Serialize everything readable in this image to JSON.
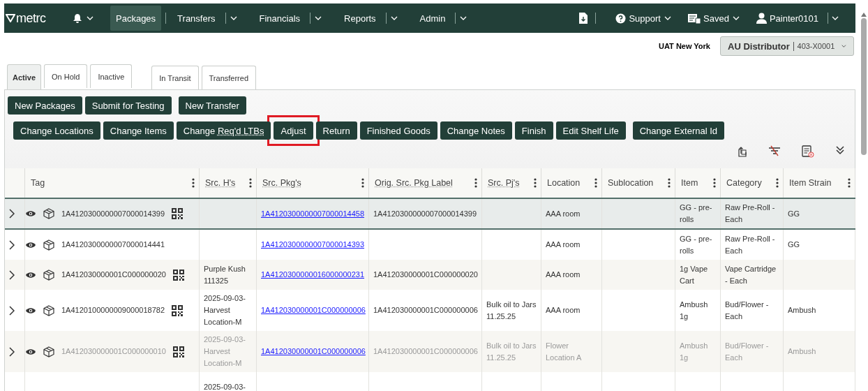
{
  "nav": {
    "logo": "metrc",
    "items": [
      {
        "label": "Packages",
        "selected": true,
        "dropdown": false
      },
      {
        "label": "Transfers",
        "selected": false,
        "dropdown": true
      },
      {
        "label": "Financials",
        "selected": false,
        "dropdown": true
      },
      {
        "label": "Reports",
        "selected": false,
        "dropdown": true
      },
      {
        "label": "Admin",
        "selected": false,
        "dropdown": true
      }
    ],
    "right_items": [
      {
        "kind": "download"
      },
      {
        "kind": "support",
        "label": "Support"
      },
      {
        "kind": "saved",
        "label": "Saved"
      },
      {
        "kind": "user",
        "label": "Painter0101"
      }
    ]
  },
  "facility": {
    "state": "UAT New York",
    "name": "AU Distributor",
    "license": "403-X0001"
  },
  "tab_groups": [
    [
      {
        "label": "Active",
        "selected": true
      },
      {
        "label": "On Hold",
        "selected": false
      },
      {
        "label": "Inactive",
        "selected": false
      }
    ],
    [
      {
        "label": "In Transit",
        "selected": false
      },
      {
        "label": "Transferred",
        "selected": false
      }
    ]
  ],
  "button_rows": [
    [
      [
        {
          "label": "New Packages",
          "highlighted": false
        },
        {
          "label": "Submit for Testing",
          "highlighted": false
        }
      ],
      [
        {
          "label": "New Transfer",
          "highlighted": false
        }
      ]
    ],
    [
      [
        {
          "label": "Change Locations",
          "highlighted": false
        },
        {
          "label": "Change Items",
          "highlighted": false
        },
        {
          "label": "Change **Req'd LTBs**",
          "highlighted": false
        },
        {
          "label": "Adjust",
          "highlighted": true
        },
        {
          "label": "Return",
          "highlighted": false
        },
        {
          "label": "Finished Goods",
          "highlighted": false
        },
        {
          "label": "Change Notes",
          "highlighted": false
        },
        {
          "label": "Finish",
          "highlighted": false
        },
        {
          "label": "Edit Shelf Life",
          "highlighted": false
        }
      ],
      [
        {
          "label": "Change External Id",
          "highlighted": false
        }
      ]
    ]
  ],
  "table": {
    "columns": [
      {
        "label": "Tag",
        "abbr": false,
        "kind": "tag"
      },
      {
        "label": "Src. H's",
        "abbr": true,
        "kind": "text"
      },
      {
        "label": "Src. Pkg's",
        "abbr": true,
        "kind": "link"
      },
      {
        "label": "Orig. Src. Pkg Label",
        "abbr": true,
        "kind": "text"
      },
      {
        "label": "Src. Pj's",
        "abbr": true,
        "kind": "text"
      },
      {
        "label": "Location",
        "abbr": false,
        "kind": "text"
      },
      {
        "label": "Sublocation",
        "abbr": false,
        "kind": "text"
      },
      {
        "label": "Item",
        "abbr": false,
        "kind": "text"
      },
      {
        "label": "Category",
        "abbr": false,
        "kind": "text"
      },
      {
        "label": "Item Strain",
        "abbr": false,
        "kind": "text"
      }
    ],
    "rows": [
      {
        "selected": true,
        "dimmed": false,
        "qr": true,
        "cells": [
          "1A4120300000007000014399",
          null,
          "1A4120300000007000014458",
          "1A4120300000007000014399",
          null,
          "AAA room",
          null,
          "GG - pre-rolls",
          "Raw Pre-Roll - Each",
          "GG"
        ]
      },
      {
        "selected": false,
        "dimmed": false,
        "qr": false,
        "cells": [
          "1A4120300000007000014441",
          null,
          "1A4120300000007000014393",
          null,
          null,
          "AAA room",
          null,
          "GG - pre-rolls",
          "Raw Pre-Roll - Each",
          "GG"
        ]
      },
      {
        "selected": false,
        "dimmed": false,
        "qr": true,
        "cells": [
          "1A412030000001C000000020",
          "Purple Kush 111325",
          "1A4120300000016000000231",
          "1A412030000001C000000020",
          null,
          "AAA room",
          null,
          "1g Vape Cart",
          "Vape Cartridge - Each",
          null
        ]
      },
      {
        "selected": false,
        "dimmed": false,
        "qr": true,
        "cells": [
          "1A4120100000009000018782",
          "2025-09-03-Harvest Location-M",
          "1A412030000001C000000006",
          "1A412030000001C000000006",
          "Bulk oil to Jars 11.25.25",
          "AAA room",
          null,
          "Ambush 1g",
          "Bud/Flower - Each",
          "Ambush"
        ]
      },
      {
        "selected": false,
        "dimmed": true,
        "qr": true,
        "cells": [
          "1A412030000001C000000010",
          "2025-09-03-Harvest Location-M",
          "1A412030000001C000000006",
          "1A412030000001C000000006",
          "Bulk oil to Jars 11.25.25",
          "Flower Location A",
          null,
          "Ambush 1g",
          "Bud/Flower - Each",
          "Ambush"
        ]
      },
      {
        "selected": false,
        "dimmed": false,
        "cells": [
          null,
          "2025-09-03-",
          null,
          null,
          null,
          null,
          null,
          null,
          null,
          null
        ]
      }
    ]
  }
}
